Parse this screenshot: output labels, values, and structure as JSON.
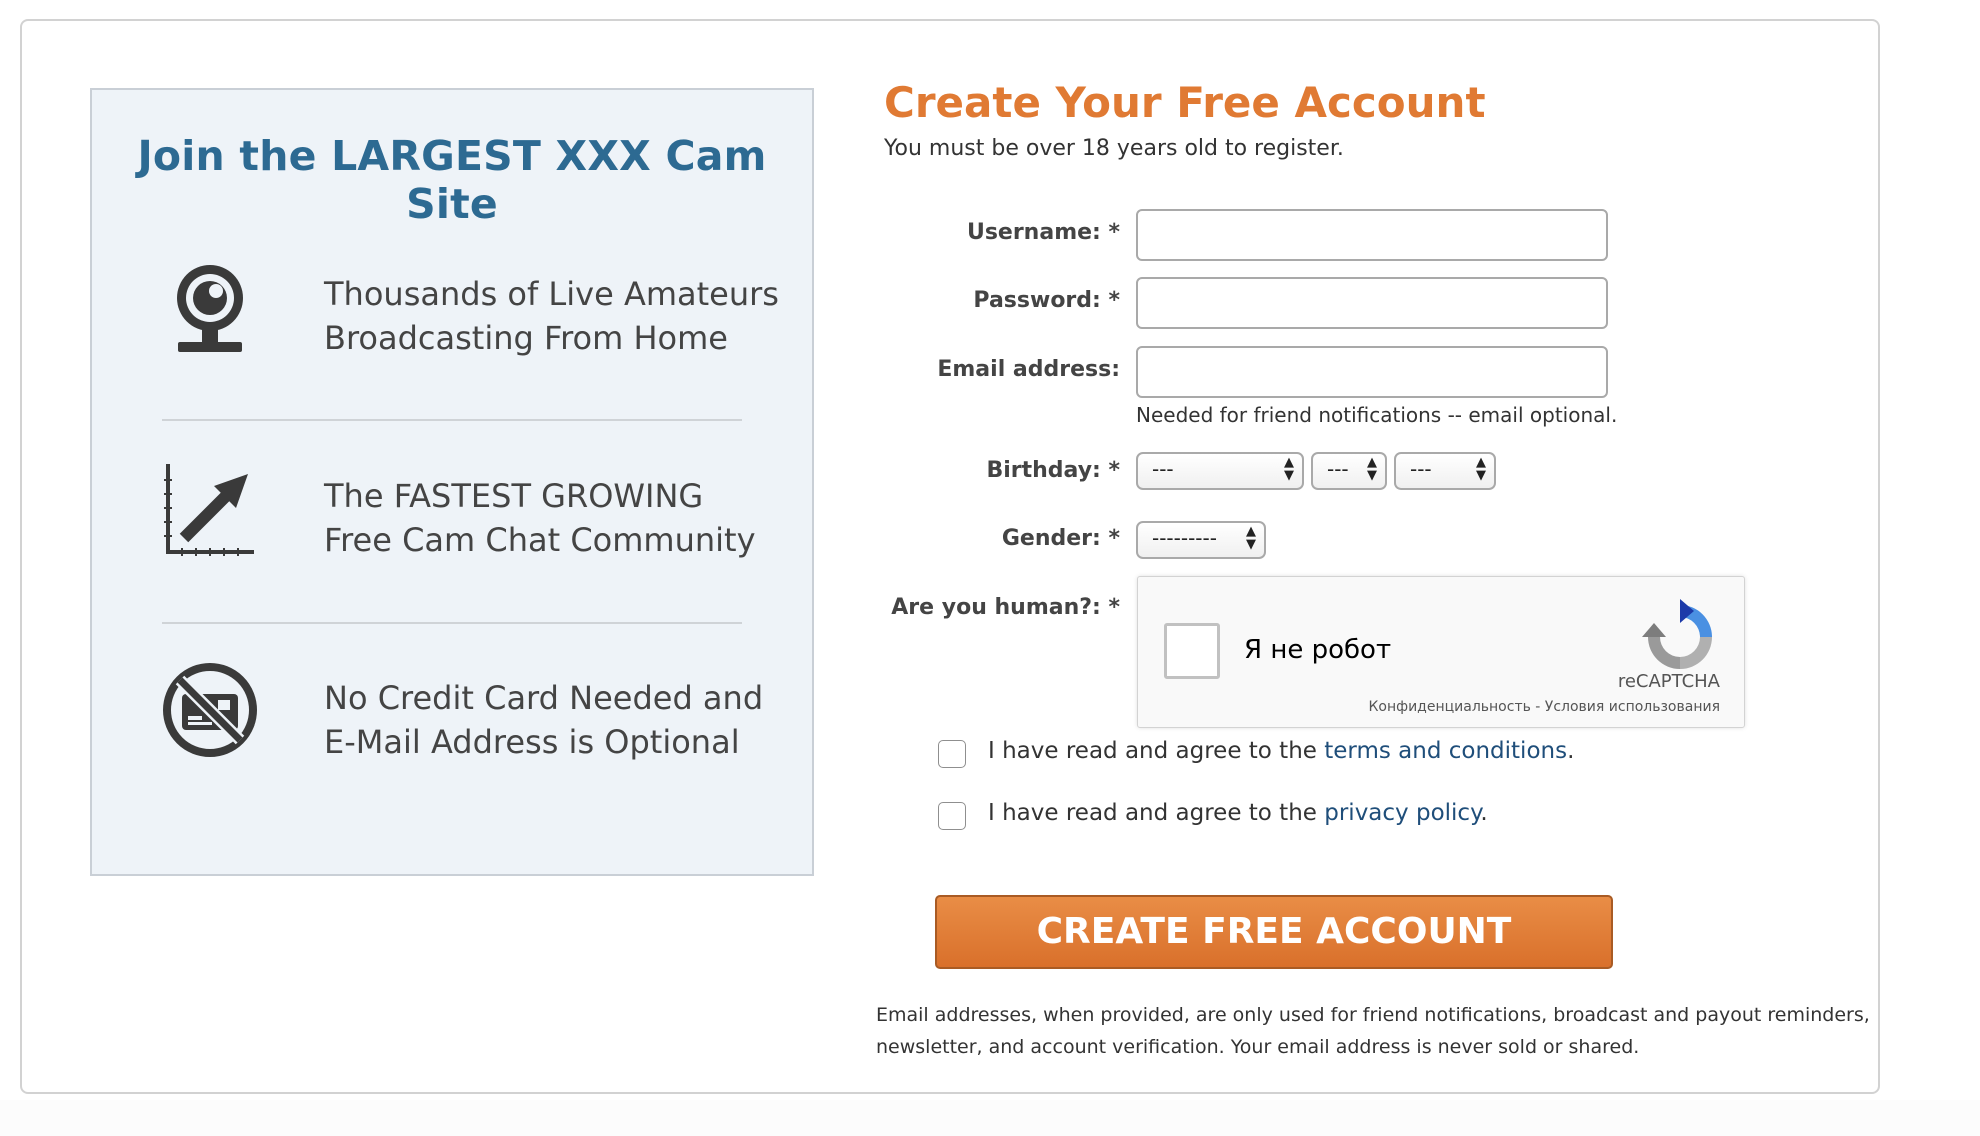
{
  "promo": {
    "title": "Join the LARGEST XXX Cam Site",
    "features": [
      {
        "icon": "webcam-icon",
        "line1": "Thousands of Live Amateurs",
        "line2": "Broadcasting From Home"
      },
      {
        "icon": "growth-arrow-icon",
        "line1": "The FASTEST GROWING",
        "line2": "Free Cam Chat Community"
      },
      {
        "icon": "no-credit-card-icon",
        "line1": "No Credit Card Needed and",
        "line2": "E-Mail Address is Optional"
      }
    ]
  },
  "form": {
    "title": "Create Your Free Account",
    "subtitle": "You must be over 18 years old to register.",
    "username_label": "Username: *",
    "password_label": "Password: *",
    "email_label": "Email address:",
    "email_hint": "Needed for friend notifications -- email optional.",
    "birthday_label": "Birthday: *",
    "birthday_month": "---",
    "birthday_day": "---",
    "birthday_year": "---",
    "gender_label": "Gender: *",
    "gender_value": "---------",
    "human_label": "Are you human?: *"
  },
  "captcha": {
    "label": "Я не робот",
    "brand": "reCAPTCHA",
    "links": "Конфиденциальность - Условия использования"
  },
  "agreements": {
    "terms_prefix": "I have read and agree to the ",
    "terms_link": "terms and conditions",
    "terms_suffix": ".",
    "privacy_prefix": "I have read and agree to the ",
    "privacy_link": "privacy policy",
    "privacy_suffix": "."
  },
  "submit_label": "CREATE FREE ACCOUNT",
  "disclaimer": {
    "line1": "Email addresses, when provided, are only used for friend notifications, broadcast and payout reminders,",
    "line2": "newsletter, and account verification. Your email address is never sold or shared."
  },
  "colors": {
    "accent_orange": "#e07a33",
    "title_blue": "#2d6a92",
    "link_blue": "#1f4e7a",
    "panel_bg": "#eef3f8"
  }
}
